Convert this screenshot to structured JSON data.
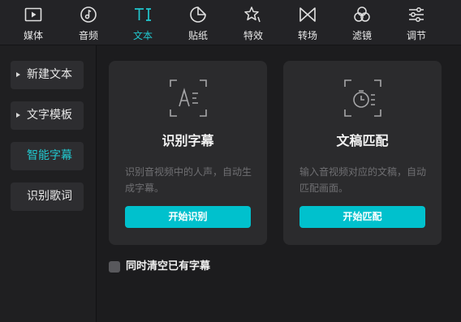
{
  "toolbar": {
    "items": [
      {
        "label": "媒体",
        "icon": "media-icon"
      },
      {
        "label": "音频",
        "icon": "audio-icon"
      },
      {
        "label": "文本",
        "icon": "text-icon",
        "active": true
      },
      {
        "label": "贴纸",
        "icon": "sticker-icon"
      },
      {
        "label": "特效",
        "icon": "effects-icon"
      },
      {
        "label": "转场",
        "icon": "transition-icon"
      },
      {
        "label": "滤镜",
        "icon": "filter-icon"
      },
      {
        "label": "调节",
        "icon": "adjust-icon"
      }
    ],
    "active_color": "#21c8cf"
  },
  "sidebar": {
    "items": [
      {
        "label": "新建文本",
        "expandable": true
      },
      {
        "label": "文字模板",
        "expandable": true
      },
      {
        "label": "智能字幕",
        "active": true
      },
      {
        "label": "识别歌词"
      }
    ]
  },
  "cards": [
    {
      "title": "识别字幕",
      "description": "识别音视频中的人声，自动生成字幕。",
      "button": "开始识别",
      "icon": "speech-recognition-icon"
    },
    {
      "title": "文稿匹配",
      "description": "输入音视频对应的文稿，自动匹配画面。",
      "button": "开始匹配",
      "icon": "script-match-icon"
    }
  ],
  "options": {
    "clear_existing_label": "同时清空已有字幕",
    "clear_existing_checked": false
  },
  "colors": {
    "accent": "#00c1cd",
    "background": "#1c1c1e",
    "card": "#2b2b2d"
  }
}
